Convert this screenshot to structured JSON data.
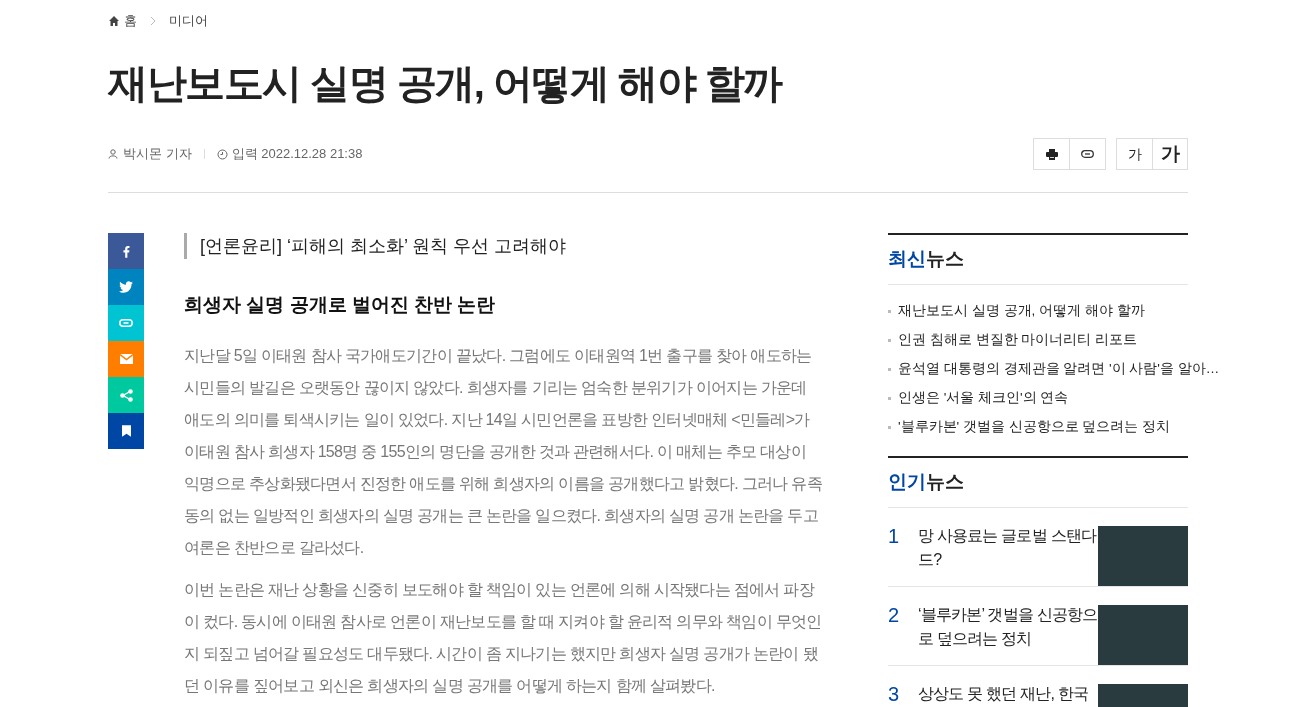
{
  "breadcrumb": {
    "home": "홈",
    "section": "미디어"
  },
  "headline": "재난보도시 실명 공개, 어떻게 해야 할까",
  "byline": {
    "author": "박시몬 기자",
    "date": "입력 2022.12.28 21:38"
  },
  "tools": {
    "font_small": "가",
    "font_large": "가"
  },
  "share": [
    {
      "kind": "facebook",
      "color": "#3b5998"
    },
    {
      "kind": "twitter",
      "color": "#0084bf"
    },
    {
      "kind": "link",
      "color": "#00c4d2"
    },
    {
      "kind": "email",
      "color": "#ff7e00"
    },
    {
      "kind": "share",
      "color": "#00c89f"
    },
    {
      "kind": "bookmark",
      "color": "#0047a5"
    }
  ],
  "article": {
    "subtitle": "[언론윤리] ‘피해의 최소화’ 원칙 우선 고려해야",
    "heading": "희생자 실명 공개로 벌어진 찬반 논란",
    "paragraphs": [
      "지난달 5일 이태원 참사 국가애도기간이 끝났다. 그럼에도 이태원역 1번 출구를 찾아 애도하는 시민들의 발길은 오랫동안 끊이지 않았다. 희생자를 기리는 엄숙한 분위기가 이어지는 가운데 애도의 의미를 퇴색시키는 일이 있었다. 지난 14일 시민언론을 표방한 인터넷매체 <민들레>가 이태원 참사 희생자 158명 중 155인의 명단을 공개한 것과 관련해서다. 이 매체는 추모 대상이 익명으로 추상화됐다면서 진정한 애도를 위해 희생자의 이름을 공개했다고 밝혔다. 그러나 유족 동의 없는 일방적인 희생자의 실명 공개는 큰 논란을 일으켰다. 희생자의 실명 공개 논란을 두고 여론은 찬반으로 갈라섰다.",
      "이번 논란은 재난 상황을 신중히 보도해야 할 책임이 있는 언론에 의해 시작됐다는 점에서 파장이 컸다. 동시에 이태원 참사로 언론이 재난보도를 할 때 지켜야 할 윤리적 의무와 책임이 무엇인지 되짚고 넘어갈 필요성도 대두됐다. 시간이 좀 지나기는 했지만 희생자 실명 공개가 논란이 됐던 이유를 짚어보고 외신은 희생자의 실명 공개를 어떻게 하는지 함께 살펴봤다."
    ]
  },
  "latest": {
    "title_highlight": "최신",
    "title_rest": "뉴스",
    "items": [
      "재난보도시 실명 공개, 어떻게 해야 할까",
      "인권 침해로 변질한 마이너리티 리포트",
      "윤석열 대통령의 경제관을 알려면 '이 사람'을 알아…",
      "인생은 '서울 체크인'의 연속",
      "'블루카본' 갯벌을 신공항으로 덮으려는 정치"
    ]
  },
  "popular": {
    "title_highlight": "인기",
    "title_rest": "뉴스",
    "items": [
      {
        "rank": "1",
        "title": "망 사용료는 글로벌 스탠다드?"
      },
      {
        "rank": "2",
        "title": "‘블루카본’ 갯벌을 신공항으로 덮으려는 정치"
      },
      {
        "rank": "3",
        "title": "상상도 못 했던 재난, 한국"
      }
    ]
  }
}
